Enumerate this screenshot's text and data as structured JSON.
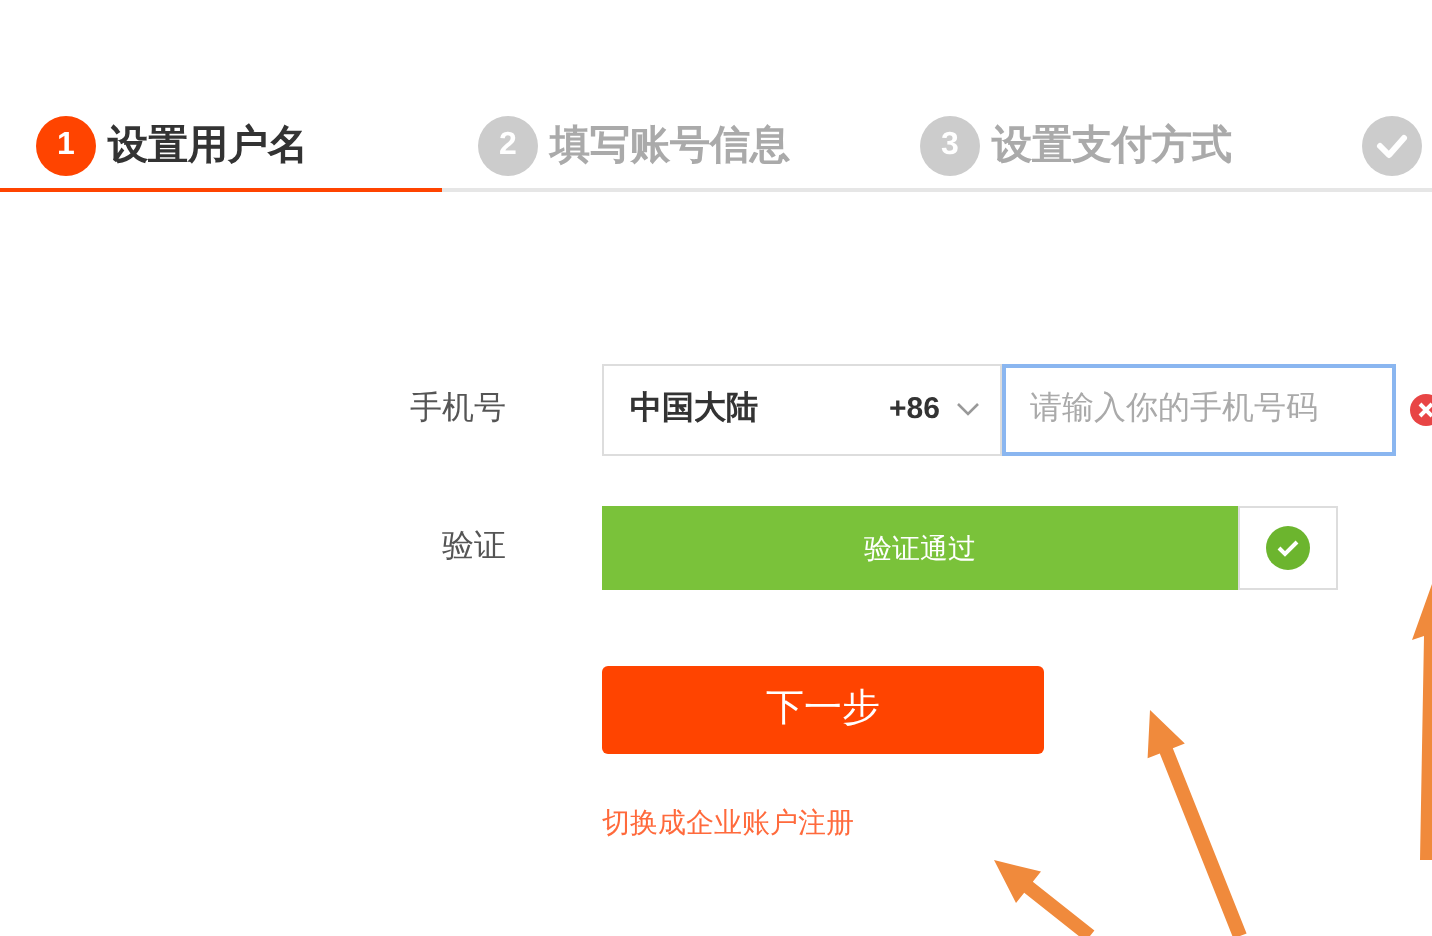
{
  "steps": [
    {
      "number": "1",
      "label": "设置用户名",
      "selected": true
    },
    {
      "number": "2",
      "label": "填写账号信息",
      "selected": false
    },
    {
      "number": "3",
      "label": "设置支付方式",
      "selected": false
    },
    {
      "kind": "check",
      "selected": false
    }
  ],
  "form": {
    "phone_label": "手机号",
    "country": "中国大陆",
    "code": "+86",
    "phone_placeholder": "请输入你的手机号码",
    "phone_focused": true,
    "phone_error": true,
    "verify_label": "验证",
    "verify_text": "验证通过",
    "verified": true,
    "next_button": "下一步",
    "switch_link": "切换成企业账户注册"
  }
}
